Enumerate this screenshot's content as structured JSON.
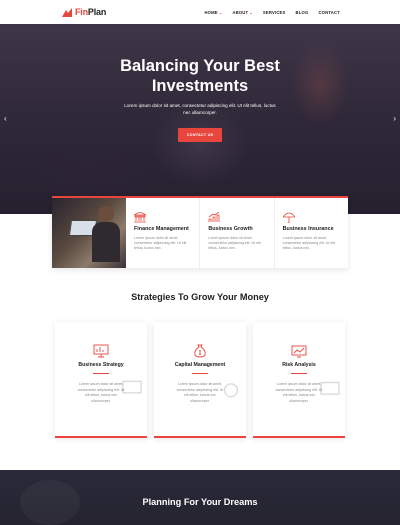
{
  "brand": {
    "logo_prefix": "Fin",
    "logo_suffix": "Plan",
    "accent": "#e8453c"
  },
  "nav": {
    "items": [
      {
        "label": "HOME",
        "caret": "⌄"
      },
      {
        "label": "ABOUT",
        "caret": "⌄"
      },
      {
        "label": "SERVICES",
        "caret": ""
      },
      {
        "label": "BLOG",
        "caret": ""
      },
      {
        "label": "CONTACT",
        "caret": ""
      }
    ]
  },
  "hero": {
    "title_line1": "Balancing Your Best",
    "title_line2": "Investments",
    "subtitle": "Lorem ipsum dolor sit amet, consectetur adipiscing elit. Ut elit tellus, luctus nec ullamcorper.",
    "cta": "CONTACT US",
    "prev": "‹",
    "next": "›"
  },
  "features": [
    {
      "icon": "bank-icon",
      "title": "Finance Management",
      "text": "Lorem ipsum dolor sit amet, consectetur adipiscing elit. Ut elit tellus, luctus nec."
    },
    {
      "icon": "growth-chart-icon",
      "title": "Business Growth",
      "text": "Lorem ipsum dolor sit amet, consectetur adipiscing elit. Ut elit tellus, luctus nec."
    },
    {
      "icon": "umbrella-icon",
      "title": "Business Insurance",
      "text": "Lorem ipsum dolor sit amet, consectetur adipiscing elit. Ut elit tellus, luctus nec."
    }
  ],
  "strategies": {
    "title": "Strategies To Grow Your Money",
    "cards": [
      {
        "icon": "presentation-board-icon",
        "title": "Business Strategy",
        "text": "Lorem ipsum dolor sit amet, consectetur adipiscing elit. Ut elit tellus, luctus nec ullamcorper."
      },
      {
        "icon": "money-bag-icon",
        "title": "Capital Management",
        "text": "Lorem ipsum dolor sit amet, consectetur adipiscing elit. Ut elit tellus, luctus nec ullamcorper."
      },
      {
        "icon": "analytics-icon",
        "title": "Risk Analysis",
        "text": "Lorem ipsum dolor sit amet, consectetur adipiscing elit. Ut elit tellus, luctus nec ullamcorper."
      }
    ]
  },
  "planning": {
    "title": "Planning For Your Dreams"
  }
}
